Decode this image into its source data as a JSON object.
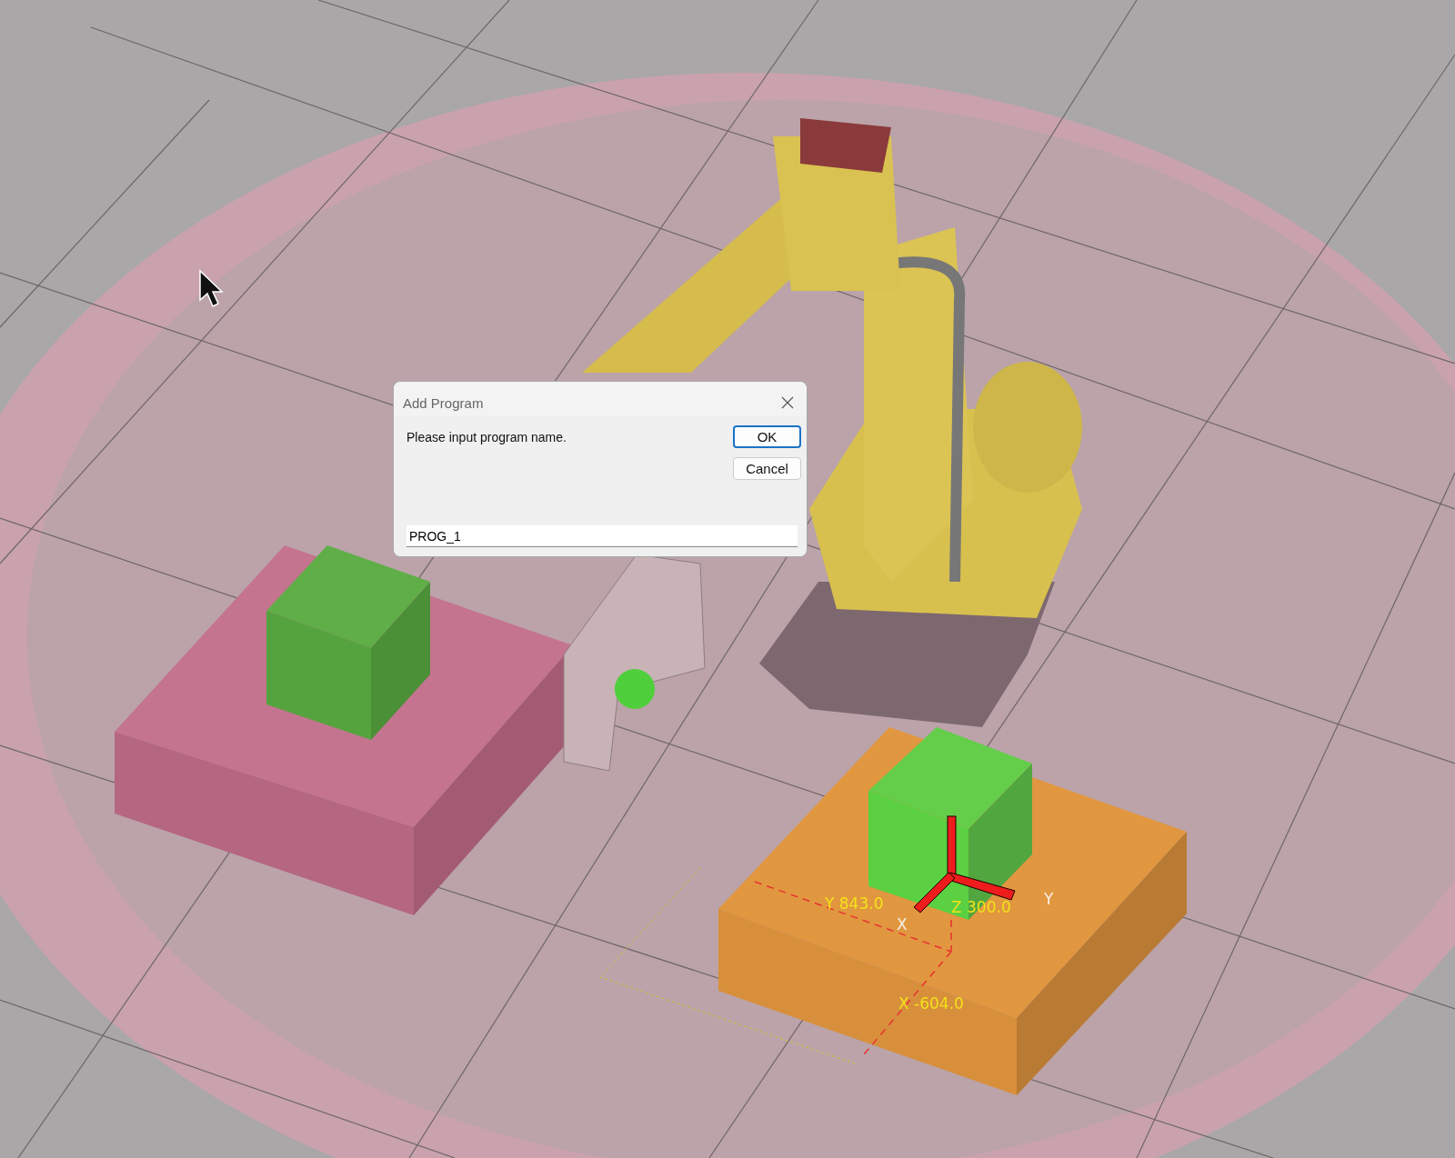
{
  "viewport": {
    "labels": [
      {
        "text": "Y 843.0",
        "kind": "coordinate"
      },
      {
        "text": "Z 300.0",
        "kind": "coordinate"
      },
      {
        "text": "X",
        "kind": "axis"
      },
      {
        "text": "Y",
        "kind": "axis"
      },
      {
        "text": "X -604.0",
        "kind": "coordinate"
      }
    ]
  },
  "dialog": {
    "title": "Add Program",
    "message": "Please input program name.",
    "buttons": [
      {
        "label": "OK",
        "selected": true
      },
      {
        "label": "Cancel",
        "selected": false
      }
    ],
    "input": {
      "value": "PROG_1"
    }
  }
}
